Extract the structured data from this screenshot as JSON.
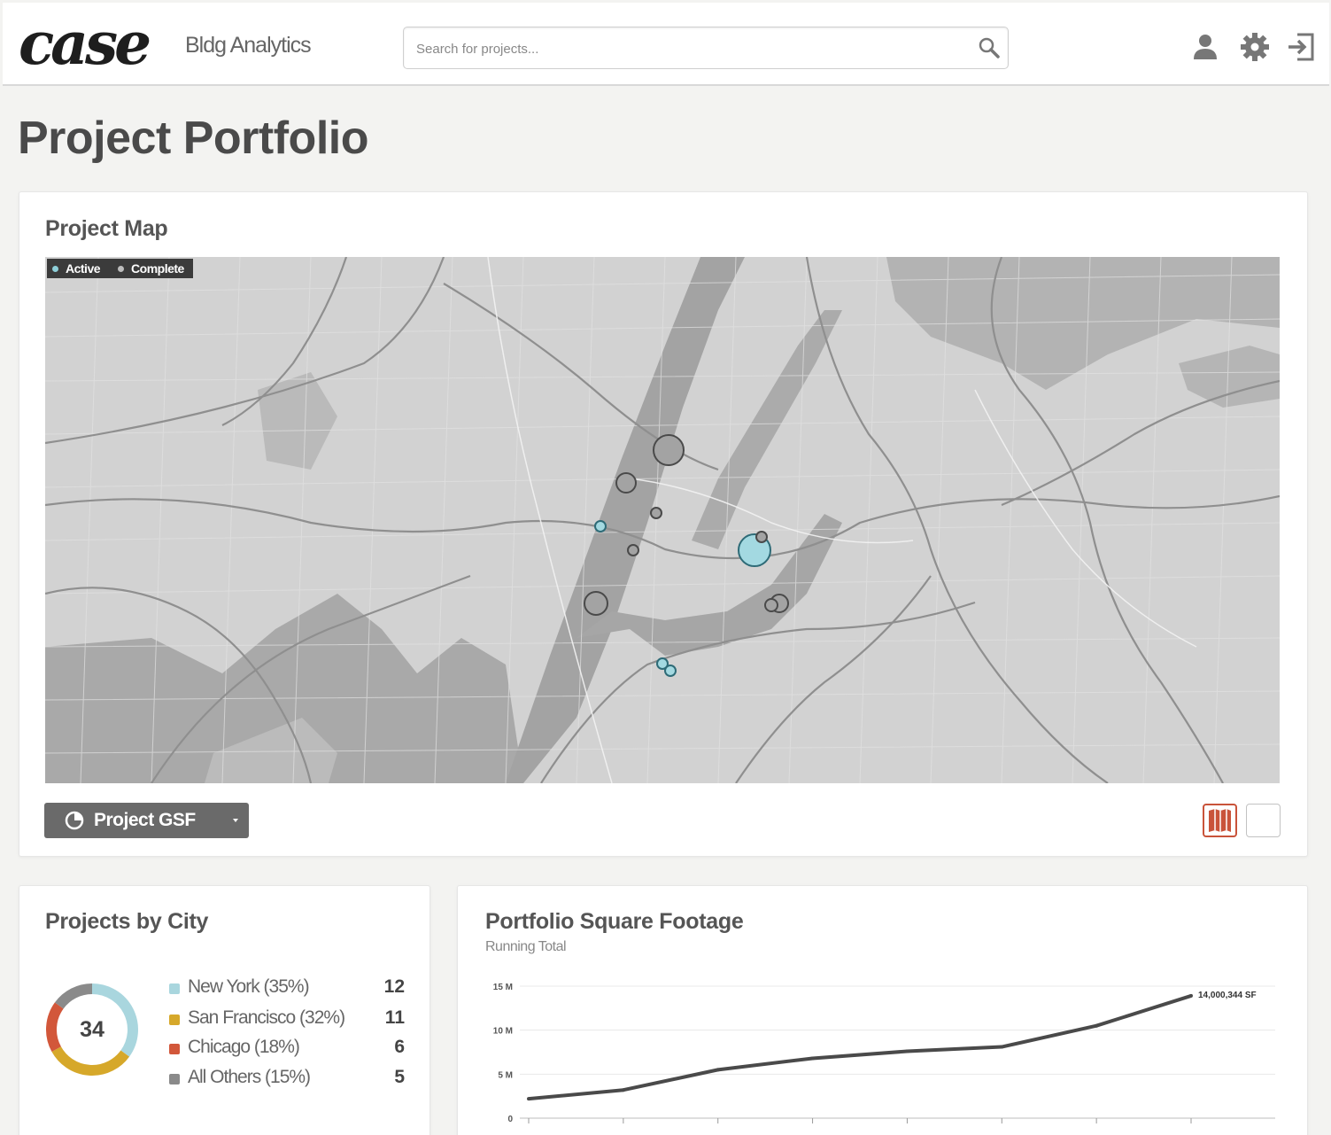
{
  "header": {
    "logo": "case",
    "logo_subtitle": "Bldg Analytics",
    "search_placeholder": "Search for projects..."
  },
  "page": {
    "title": "Project Portfolio"
  },
  "map_card": {
    "title": "Project Map",
    "legend": [
      {
        "label": "Active",
        "color": "#8ecfd9"
      },
      {
        "label": "Complete",
        "color": "#bdbdbd"
      }
    ],
    "metric_button": "Project GSF",
    "projects": [
      {
        "status": "complete",
        "gsf_rank": 3
      },
      {
        "status": "complete",
        "gsf_rank": 2
      },
      {
        "status": "complete",
        "gsf_rank": 1
      },
      {
        "status": "active",
        "gsf_rank": 1
      },
      {
        "status": "complete",
        "gsf_rank": 1
      },
      {
        "status": "active",
        "gsf_rank": 3
      },
      {
        "status": "complete",
        "gsf_rank": 1
      },
      {
        "status": "complete",
        "gsf_rank": 2
      },
      {
        "status": "complete",
        "gsf_rank": 2
      },
      {
        "status": "complete",
        "gsf_rank": 2
      },
      {
        "status": "active",
        "gsf_rank": 1
      },
      {
        "status": "active",
        "gsf_rank": 1
      }
    ]
  },
  "city_card": {
    "title": "Projects by City",
    "total": "34",
    "cities": [
      {
        "label": "New York (35%)",
        "count": "12",
        "color": "#a9d6de",
        "share": 0.35
      },
      {
        "label": "San Francisco (32%)",
        "count": "11",
        "color": "#d6a82a",
        "share": 0.32
      },
      {
        "label": "Chicago (18%)",
        "count": "6",
        "color": "#d2573a",
        "share": 0.18
      },
      {
        "label": "All Others (15%)",
        "count": "5",
        "color": "#8a8a8a",
        "share": 0.15
      }
    ]
  },
  "chart_data": {
    "type": "line",
    "title": "Portfolio Square Footage",
    "subtitle": "Running Total",
    "y_ticks": [
      "0",
      "5 M",
      "10 M",
      "15 M"
    ],
    "ylim": [
      0,
      15000000
    ],
    "x_index": [
      0,
      1,
      2,
      3,
      4,
      5,
      6,
      7
    ],
    "values": [
      2200000,
      3200000,
      5500000,
      6800000,
      7600000,
      8100000,
      10500000,
      13900000
    ],
    "end_label": "14,000,344 SF",
    "grid": true
  }
}
